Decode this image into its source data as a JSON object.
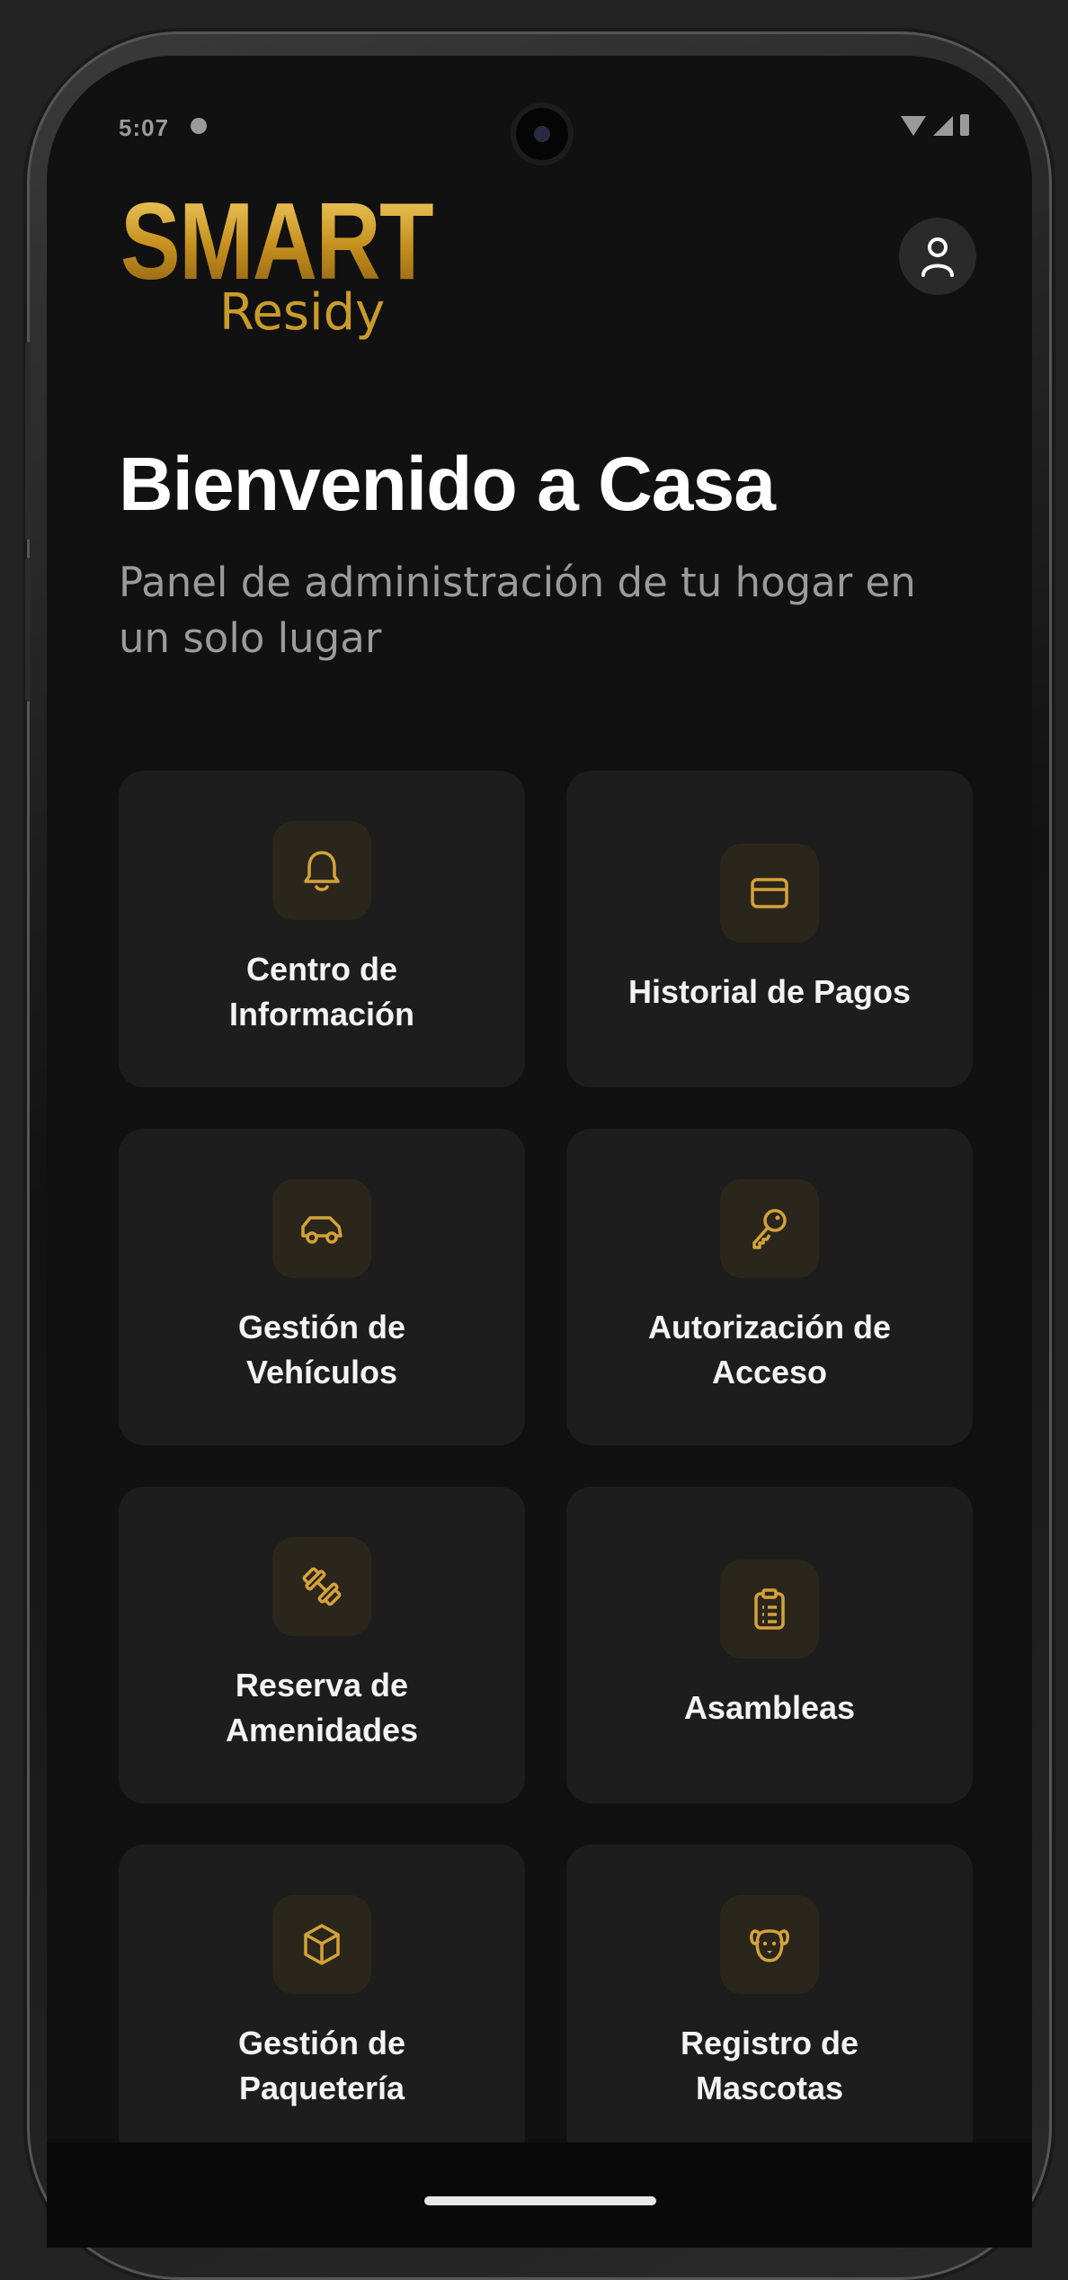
{
  "status_bar": {
    "time": "5:07"
  },
  "brand": {
    "logo_main": "SMART",
    "logo_sub": "Residy"
  },
  "header": {
    "title": "Bienvenido a Casa",
    "subtitle": "Panel de administración de tu hogar en un solo lugar"
  },
  "menu": {
    "items": [
      {
        "label": "Centro de Información",
        "icon": "bell-icon"
      },
      {
        "label": "Historial de Pagos",
        "icon": "credit-card-icon"
      },
      {
        "label": "Gestión de Vehículos",
        "icon": "car-icon"
      },
      {
        "label": "Autorización de Acceso",
        "icon": "key-icon"
      },
      {
        "label": "Reserva de Amenidades",
        "icon": "dumbbell-icon"
      },
      {
        "label": "Asambleas",
        "icon": "clipboard-icon"
      },
      {
        "label": "Gestión de Paquetería",
        "icon": "package-icon"
      },
      {
        "label": "Registro de Mascotas",
        "icon": "dog-icon"
      }
    ]
  },
  "colors": {
    "background": "#111111",
    "card": "#1d1d1d",
    "accent_gold": "#d4a23a",
    "text_primary": "#ffffff",
    "text_secondary": "#9b9b9b"
  }
}
